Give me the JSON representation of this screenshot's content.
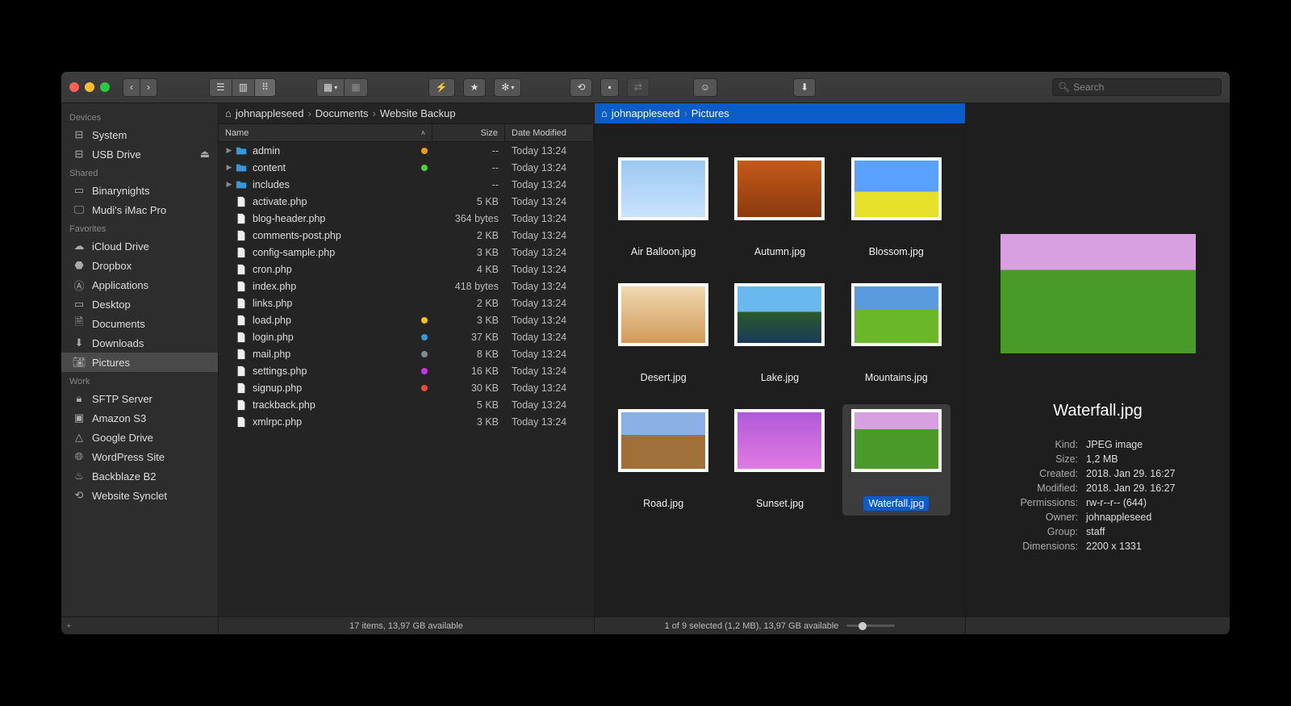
{
  "search": {
    "placeholder": "Search"
  },
  "sidebar": {
    "sections": [
      {
        "title": "Devices",
        "items": [
          {
            "label": "System",
            "icon": "drive"
          },
          {
            "label": "USB Drive",
            "icon": "drive",
            "eject": true
          }
        ]
      },
      {
        "title": "Shared",
        "items": [
          {
            "label": "Binarynights",
            "icon": "computer"
          },
          {
            "label": "Mudi's iMac Pro",
            "icon": "display"
          }
        ]
      },
      {
        "title": "Favorites",
        "items": [
          {
            "label": "iCloud Drive",
            "icon": "cloud"
          },
          {
            "label": "Dropbox",
            "icon": "dropbox"
          },
          {
            "label": "Applications",
            "icon": "apps"
          },
          {
            "label": "Desktop",
            "icon": "desktop"
          },
          {
            "label": "Documents",
            "icon": "doc"
          },
          {
            "label": "Downloads",
            "icon": "download"
          },
          {
            "label": "Pictures",
            "icon": "pictures",
            "selected": true
          }
        ]
      },
      {
        "title": "Work",
        "items": [
          {
            "label": "SFTP Server",
            "icon": "lock"
          },
          {
            "label": "Amazon S3",
            "icon": "s3"
          },
          {
            "label": "Google Drive",
            "icon": "gdrive"
          },
          {
            "label": "WordPress Site",
            "icon": "globe"
          },
          {
            "label": "Backblaze B2",
            "icon": "flame"
          },
          {
            "label": "Website Synclet",
            "icon": "sync"
          }
        ]
      }
    ]
  },
  "pane1": {
    "breadcrumb": [
      "johnappleseed",
      "Documents",
      "Website Backup"
    ],
    "columns": {
      "name": "Name",
      "size": "Size",
      "date": "Date Modified"
    },
    "rows": [
      {
        "name": "admin",
        "folder": true,
        "size": "--",
        "date": "Today 13:24",
        "tag": "#f39c12"
      },
      {
        "name": "content",
        "folder": true,
        "size": "--",
        "date": "Today 13:24",
        "tag": "#4cd137"
      },
      {
        "name": "includes",
        "folder": true,
        "size": "--",
        "date": "Today 13:24"
      },
      {
        "name": "activate.php",
        "size": "5 KB",
        "date": "Today 13:24"
      },
      {
        "name": "blog-header.php",
        "size": "364 bytes",
        "date": "Today 13:24"
      },
      {
        "name": "comments-post.php",
        "size": "2 KB",
        "date": "Today 13:24"
      },
      {
        "name": "config-sample.php",
        "size": "3 KB",
        "date": "Today 13:24"
      },
      {
        "name": "cron.php",
        "size": "4 KB",
        "date": "Today 13:24"
      },
      {
        "name": "index.php",
        "size": "418 bytes",
        "date": "Today 13:24"
      },
      {
        "name": "links.php",
        "size": "2 KB",
        "date": "Today 13:24"
      },
      {
        "name": "load.php",
        "size": "3 KB",
        "date": "Today 13:24",
        "tag": "#f1c40f"
      },
      {
        "name": "login.php",
        "size": "37 KB",
        "date": "Today 13:24",
        "tag": "#3498db"
      },
      {
        "name": "mail.php",
        "size": "8 KB",
        "date": "Today 13:24",
        "tag": "#7f8c8d"
      },
      {
        "name": "settings.php",
        "size": "16 KB",
        "date": "Today 13:24",
        "tag": "#c634eb"
      },
      {
        "name": "signup.php",
        "size": "30 KB",
        "date": "Today 13:24",
        "tag": "#e74c3c"
      },
      {
        "name": "trackback.php",
        "size": "5 KB",
        "date": "Today 13:24"
      },
      {
        "name": "xmlrpc.php",
        "size": "3 KB",
        "date": "Today 13:24"
      }
    ],
    "status": "17 items, 13,97 GB available"
  },
  "pane2": {
    "breadcrumb": [
      "johnappleseed",
      "Pictures"
    ],
    "thumbs": [
      {
        "name": "Air Balloon.jpg",
        "bg": "linear-gradient(#9cc8f0,#c9e3ff)"
      },
      {
        "name": "Autumn.jpg",
        "bg": "linear-gradient(#c45a1a,#8b3a0e)"
      },
      {
        "name": "Blossom.jpg",
        "bg": "linear-gradient(#5aa0ff 0%,#5aa0ff 55%,#e6e02a 55%)"
      },
      {
        "name": "Desert.jpg",
        "bg": "linear-gradient(#f0d9b0,#d19a5a)"
      },
      {
        "name": "Lake.jpg",
        "bg": "linear-gradient(#6ab8f0 0%,#6ab8f0 45%,#2a5a2a 45%,#1a3a5a 100%)"
      },
      {
        "name": "Mountains.jpg",
        "bg": "linear-gradient(#5a9be0 0%,#5a9be0 40%,#6ab82a 40%)"
      },
      {
        "name": "Road.jpg",
        "bg": "linear-gradient(#8ab0e5 0%,#8ab0e5 40%,#a0703a 40%)"
      },
      {
        "name": "Sunset.jpg",
        "bg": "linear-gradient(#b05ad9,#e07ae0)"
      },
      {
        "name": "Waterfall.jpg",
        "bg": "linear-gradient(#d8a0e0 0%,#d8a0e0 30%,#4a9a2a 30%)",
        "selected": true
      }
    ],
    "status": "1 of 9 selected (1,2 MB), 13,97 GB available"
  },
  "info": {
    "title": "Waterfall.jpg",
    "preview_bg": "linear-gradient(#d8a0e0 0%,#d8a0e0 30%,#4a9a2a 30%)",
    "fields": [
      {
        "k": "Kind:",
        "v": "JPEG image"
      },
      {
        "k": "Size:",
        "v": "1,2 MB"
      },
      {
        "k": "Created:",
        "v": "2018. Jan 29. 16:27"
      },
      {
        "k": "Modified:",
        "v": "2018. Jan 29. 16:27"
      },
      {
        "k": "Permissions:",
        "v": "rw-r--r-- (644)"
      },
      {
        "k": "Owner:",
        "v": "johnappleseed"
      },
      {
        "k": "Group:",
        "v": "staff"
      },
      {
        "k": "Dimensions:",
        "v": "2200 x 1331"
      }
    ]
  }
}
